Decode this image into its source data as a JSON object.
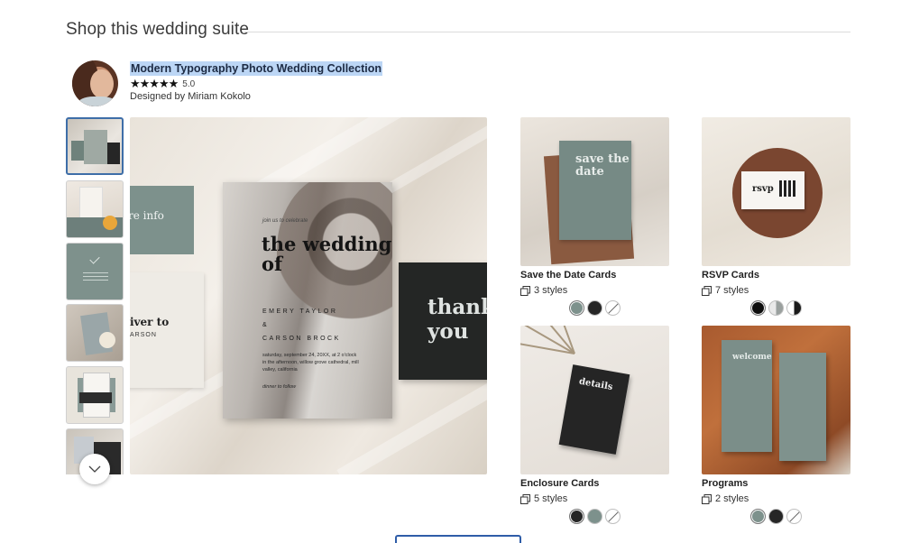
{
  "section": {
    "title": "Shop this wedding suite"
  },
  "collection": {
    "title": "Modern Typography Photo Wedding Collection",
    "stars": "★★★★★",
    "rating": "5.0",
    "designer": "Designed by Miriam Kokolo"
  },
  "main_image": {
    "invite": {
      "pre": "join us to celebrate",
      "headline": "the wedding of",
      "name1": "EMERY TAYLOR",
      "amp": "&",
      "name2": "CARSON BROCK",
      "details": "saturday, september 24, 20XX, at 2 o'clock in the afternoon, willow grove cathedral, mill valley, california",
      "dinner": "dinner to follow"
    },
    "left_card_text": "re info",
    "left_card2_text": "iver to",
    "left_card2_sub": "ARSON",
    "thanks_text": "thank you"
  },
  "products": [
    {
      "name": "Save the Date Cards",
      "styles": "3 styles",
      "card_text": "save the date",
      "swatches": [
        {
          "color": "#7d918c",
          "selected": true
        },
        {
          "color": "#262626"
        },
        {
          "color": "none"
        }
      ]
    },
    {
      "name": "RSVP Cards",
      "styles": "7 styles",
      "card_text": "rsvp",
      "swatches": [
        {
          "color": "#0d0d0d",
          "selected": true
        },
        {
          "color": "half-white"
        },
        {
          "color": "half-black"
        }
      ]
    },
    {
      "name": "Enclosure Cards",
      "styles": "5 styles",
      "card_text": "details",
      "swatches": [
        {
          "color": "#262626",
          "selected": true
        },
        {
          "color": "#7d918c"
        },
        {
          "color": "none"
        }
      ]
    },
    {
      "name": "Programs",
      "styles": "2 styles",
      "card_text": "welcome",
      "swatches": [
        {
          "color": "#7d918c",
          "selected": true
        },
        {
          "color": "#262626"
        },
        {
          "color": "none"
        }
      ]
    }
  ],
  "icons": {
    "scroll": "chevron-down-icon",
    "styles": "copy-stack-icon"
  },
  "colors": {
    "highlight": "#bcd6f5",
    "active_border": "#3e6ea8",
    "button_outline": "#2f5da8"
  }
}
